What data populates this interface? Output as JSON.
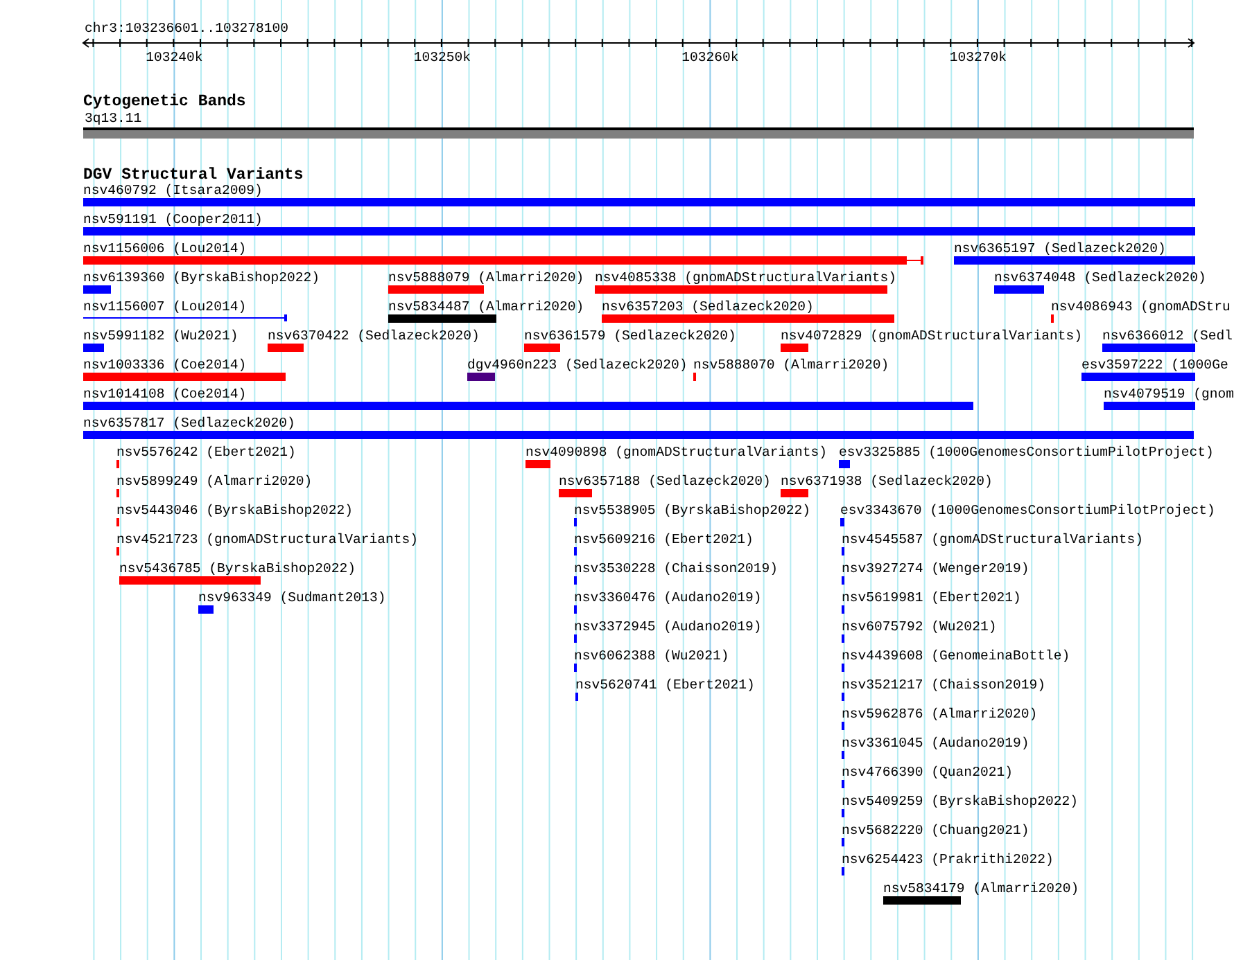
{
  "ruler": {
    "location": "chr3:103236601..103278100",
    "ticks": [
      {
        "label": "103240k"
      },
      {
        "label": "103250k"
      },
      {
        "label": "103260k"
      },
      {
        "label": "103270k"
      }
    ]
  },
  "cytoband_track": {
    "title": "Cytogenetic Bands",
    "band": "3q13.11"
  },
  "variant_track": {
    "title": "DGV Structural Variants",
    "rows": [
      {
        "features": [
          {
            "label": "nsv460792 (Itsara2009)",
            "color": "#0000ff",
            "kind": "box"
          }
        ]
      },
      {
        "features": [
          {
            "label": "nsv591191 (Cooper2011)",
            "color": "#0000ff",
            "kind": "box"
          }
        ]
      },
      {
        "features": [
          {
            "label": "nsv1156006 (Lou2014)",
            "color": "#ff0000",
            "kind": "box_tail"
          },
          {
            "label": "nsv6365197 (Sedlazeck2020)",
            "color": "#0000ff",
            "kind": "box"
          }
        ]
      },
      {
        "features": [
          {
            "label": "nsv6139360 (ByrskaBishop2022)",
            "color": "#0000ff",
            "kind": "box"
          },
          {
            "label": "nsv5888079 (Almarri2020)",
            "color": "#ff0000",
            "kind": "box"
          },
          {
            "label": "nsv4085338 (gnomADStructuralVariants)",
            "color": "#ff0000",
            "kind": "box"
          },
          {
            "label": "nsv6374048 (Sedlazeck2020)",
            "color": "#0000ff",
            "kind": "box"
          }
        ]
      },
      {
        "features": [
          {
            "label": "nsv1156007 (Lou2014)",
            "color": "#0000ff",
            "kind": "line"
          },
          {
            "label": "nsv5834487 (Almarri2020)",
            "color": "#000000",
            "kind": "box"
          },
          {
            "label": "nsv6357203 (Sedlazeck2020)",
            "color": "#ff0000",
            "kind": "box"
          },
          {
            "label": "nsv4086943 (gnomADStru",
            "color": "#ff0000",
            "kind": "box"
          }
        ]
      },
      {
        "features": [
          {
            "label": "nsv5991182 (Wu2021)",
            "color": "#0000ff",
            "kind": "box"
          },
          {
            "label": "nsv6370422 (Sedlazeck2020)",
            "color": "#ff0000",
            "kind": "box"
          },
          {
            "label": "nsv6361579 (Sedlazeck2020)",
            "color": "#ff0000",
            "kind": "box"
          },
          {
            "label": "nsv4072829 (gnomADStructuralVariants)",
            "color": "#ff0000",
            "kind": "box"
          },
          {
            "label": "nsv6366012 (Sedl",
            "color": "#0000ff",
            "kind": "box"
          }
        ]
      },
      {
        "features": [
          {
            "label": "nsv1003336 (Coe2014)",
            "color": "#ff0000",
            "kind": "box"
          },
          {
            "label": "dgv4960n223 (Sedlazeck2020)",
            "color": "#4b0082",
            "kind": "box"
          },
          {
            "label": "nsv5888070 (Almarri2020)",
            "color": "#ff0000",
            "kind": "box"
          },
          {
            "label": "esv3597222 (1000Ge",
            "color": "#0000ff",
            "kind": "box"
          }
        ]
      },
      {
        "features": [
          {
            "label": "nsv1014108 (Coe2014)",
            "color": "#0000ff",
            "kind": "box"
          },
          {
            "label": "nsv4079519 (gnom",
            "color": "#0000ff",
            "kind": "box"
          }
        ]
      },
      {
        "features": [
          {
            "label": "nsv6357817 (Sedlazeck2020)",
            "color": "#0000ff",
            "kind": "box"
          }
        ]
      },
      {
        "features": [
          {
            "label": "nsv5576242 (Ebert2021)",
            "color": "#ff0000",
            "kind": "box"
          },
          {
            "label": "nsv4090898 (gnomADStructuralVariants)",
            "color": "#ff0000",
            "kind": "box"
          },
          {
            "label": "esv3325885 (1000GenomesConsortiumPilotProject)",
            "color": "#0000ff",
            "kind": "box"
          }
        ]
      },
      {
        "features": [
          {
            "label": "nsv5899249 (Almarri2020)",
            "color": "#ff0000",
            "kind": "box"
          },
          {
            "label": "nsv6357188 (Sedlazeck2020)",
            "color": "#ff0000",
            "kind": "box"
          },
          {
            "label": "nsv6371938 (Sedlazeck2020)",
            "color": "#ff0000",
            "kind": "box"
          }
        ]
      },
      {
        "features": [
          {
            "label": "nsv5443046 (ByrskaBishop2022)",
            "color": "#ff0000",
            "kind": "box"
          },
          {
            "label": "nsv5538905 (ByrskaBishop2022)",
            "color": "#0000ff",
            "kind": "box"
          },
          {
            "label": "esv3343670 (1000GenomesConsortiumPilotProject)",
            "color": "#0000ff",
            "kind": "box"
          }
        ]
      },
      {
        "features": [
          {
            "label": "nsv4521723 (gnomADStructuralVariants)",
            "color": "#ff0000",
            "kind": "box"
          },
          {
            "label": "nsv5609216 (Ebert2021)",
            "color": "#0000ff",
            "kind": "box"
          },
          {
            "label": "nsv4545587 (gnomADStructuralVariants)",
            "color": "#0000ff",
            "kind": "box"
          }
        ]
      },
      {
        "features": [
          {
            "label": "nsv5436785 (ByrskaBishop2022)",
            "color": "#ff0000",
            "kind": "box"
          },
          {
            "label": "nsv3530228 (Chaisson2019)",
            "color": "#0000ff",
            "kind": "box"
          },
          {
            "label": "nsv3927274 (Wenger2019)",
            "color": "#0000ff",
            "kind": "box"
          }
        ]
      },
      {
        "features": [
          {
            "label": "nsv963349 (Sudmant2013)",
            "color": "#0000ff",
            "kind": "box"
          },
          {
            "label": "nsv3360476 (Audano2019)",
            "color": "#0000ff",
            "kind": "box"
          },
          {
            "label": "nsv5619981 (Ebert2021)",
            "color": "#0000ff",
            "kind": "box"
          }
        ]
      },
      {
        "features": [
          {
            "label": "nsv3372945 (Audano2019)",
            "color": "#0000ff",
            "kind": "box"
          },
          {
            "label": "nsv6075792 (Wu2021)",
            "color": "#0000ff",
            "kind": "box"
          }
        ]
      },
      {
        "features": [
          {
            "label": "nsv6062388 (Wu2021)",
            "color": "#0000ff",
            "kind": "box"
          },
          {
            "label": "nsv4439608 (GenomeinaBottle)",
            "color": "#0000ff",
            "kind": "box"
          }
        ]
      },
      {
        "features": [
          {
            "label": "nsv5620741 (Ebert2021)",
            "color": "#0000ff",
            "kind": "box"
          },
          {
            "label": "nsv3521217 (Chaisson2019)",
            "color": "#0000ff",
            "kind": "box"
          }
        ]
      },
      {
        "features": [
          {
            "label": "nsv5962876 (Almarri2020)",
            "color": "#0000ff",
            "kind": "box"
          }
        ]
      },
      {
        "features": [
          {
            "label": "nsv3361045 (Audano2019)",
            "color": "#0000ff",
            "kind": "box"
          }
        ]
      },
      {
        "features": [
          {
            "label": "nsv4766390 (Quan2021)",
            "color": "#0000ff",
            "kind": "box"
          }
        ]
      },
      {
        "features": [
          {
            "label": "nsv5409259 (ByrskaBishop2022)",
            "color": "#0000ff",
            "kind": "box"
          }
        ]
      },
      {
        "features": [
          {
            "label": "nsv5682220 (Chuang2021)",
            "color": "#0000ff",
            "kind": "box"
          }
        ]
      },
      {
        "features": [
          {
            "label": "nsv6254423 (Prakrithi2022)",
            "color": "#0000ff",
            "kind": "box"
          }
        ]
      },
      {
        "features": [
          {
            "label": "nsv5834179 (Almarri2020)",
            "color": "#000000",
            "kind": "box"
          }
        ]
      }
    ]
  }
}
